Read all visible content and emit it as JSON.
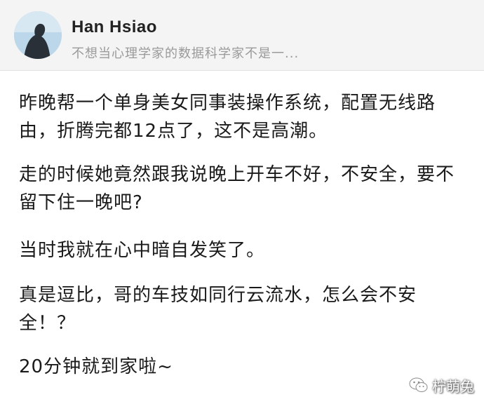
{
  "author": {
    "name": "Han Hsiao",
    "bio": "不想当心理学家的数据科学家不是一..."
  },
  "post": {
    "paragraphs": [
      "昨晚帮一个单身美女同事装操作系统，配置无线路由，折腾完都12点了，这不是高潮。",
      "走的时候她竟然跟我说晚上开车不好，不安全，要不留下住一晚吧?",
      "当时我就在心中暗自发笑了。",
      "真是逗比，哥的车技如同行云流水，怎么会不安全！？",
      "20分钟就到家啦~"
    ]
  },
  "watermark": {
    "text": "柠萌兔",
    "icon": "wechat-logo-icon"
  },
  "colors": {
    "header_bg": "#f4f4f4",
    "body_bg": "#ffffff",
    "name": "#222222",
    "bio": "#9a9a9a",
    "text": "#1a1a1a"
  }
}
